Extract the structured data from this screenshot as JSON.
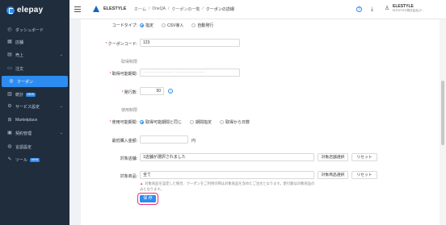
{
  "sidebar": {
    "logo": "elepay",
    "items": [
      {
        "label": "ダッシュボード",
        "icon": "dashboard-icon",
        "glyph": "◴"
      },
      {
        "label": "店舗",
        "icon": "store-icon",
        "glyph": "▦"
      },
      {
        "label": "売上",
        "icon": "sales-icon",
        "glyph": "▤",
        "chevron": "⌄"
      },
      {
        "label": "注文",
        "icon": "order-icon",
        "glyph": "▭"
      },
      {
        "label": "クーポン",
        "icon": "coupon-icon",
        "glyph": "◎",
        "active": true
      },
      {
        "label": "統計",
        "icon": "stats-icon",
        "glyph": "▥",
        "badge": "NEW"
      },
      {
        "label": "サービス設定",
        "icon": "service-settings-icon",
        "glyph": "⚙",
        "chevron": "⌄"
      },
      {
        "label": "Marketplace",
        "icon": "marketplace-icon",
        "glyph": "⊞"
      },
      {
        "label": "契約管理",
        "icon": "contract-icon",
        "glyph": "▣",
        "chevron": "⌄"
      },
      {
        "label": "言語設定",
        "icon": "language-icon",
        "glyph": "◍"
      },
      {
        "label": "ツール",
        "icon": "tool-icon",
        "glyph": "✎",
        "badge": "NEW"
      }
    ]
  },
  "header": {
    "brand": "ELESTYLE",
    "breadcrumbs": [
      "ホーム",
      "OneQA",
      "クーポンの一覧",
      "クーポンの詳細"
    ],
    "help_glyph": "?",
    "download_glyph": "⤓",
    "user_glyph": "♙",
    "user_name": "ELESTYLE",
    "user_sub": "ELESTYLE株式会社(テ..."
  },
  "form": {
    "code_type_label": "コードタイプ:",
    "code_type_options": [
      "指定",
      "CSV導入",
      "自動発行"
    ],
    "coupon_code_label": "クーポンコード:",
    "coupon_code_value": "123",
    "section_acquire": "取得制限",
    "acquire_period_label": "取得可能期間:",
    "acquire_period_value": "———————— ~ ————————",
    "issue_count_label": "発行数:",
    "issue_count_value": "50",
    "help_glyph": "?",
    "section_use": "使用制限",
    "use_period_label": "使用可能期間:",
    "use_period_options": [
      "取得可能期間と同じ",
      "期間指定",
      "取得から日数"
    ],
    "min_amount_label": "最低購入金額:",
    "min_amount_value": "",
    "currency_unit": "円",
    "target_store_label": "対象店舗:",
    "target_store_value": "1店舗が選択されました",
    "target_store_select_button": "対象店舗選択",
    "target_store_reset_button": "リセット",
    "target_product_label": "対象商品:",
    "target_product_value": "全て",
    "target_product_select_button": "対象商品選択",
    "target_product_reset_button": "リセット",
    "warn_glyph": "▲",
    "note": "対象商品を設定した場合、クーポンをご利用の際は対象商品を含めたご注文となります。割引額は対象商品のみとなります。",
    "save_button": "保 存"
  },
  "colors": {
    "sidebar_bg": "#1f2d3d",
    "accent": "#2d8cf0",
    "highlight": "#e8337a"
  }
}
